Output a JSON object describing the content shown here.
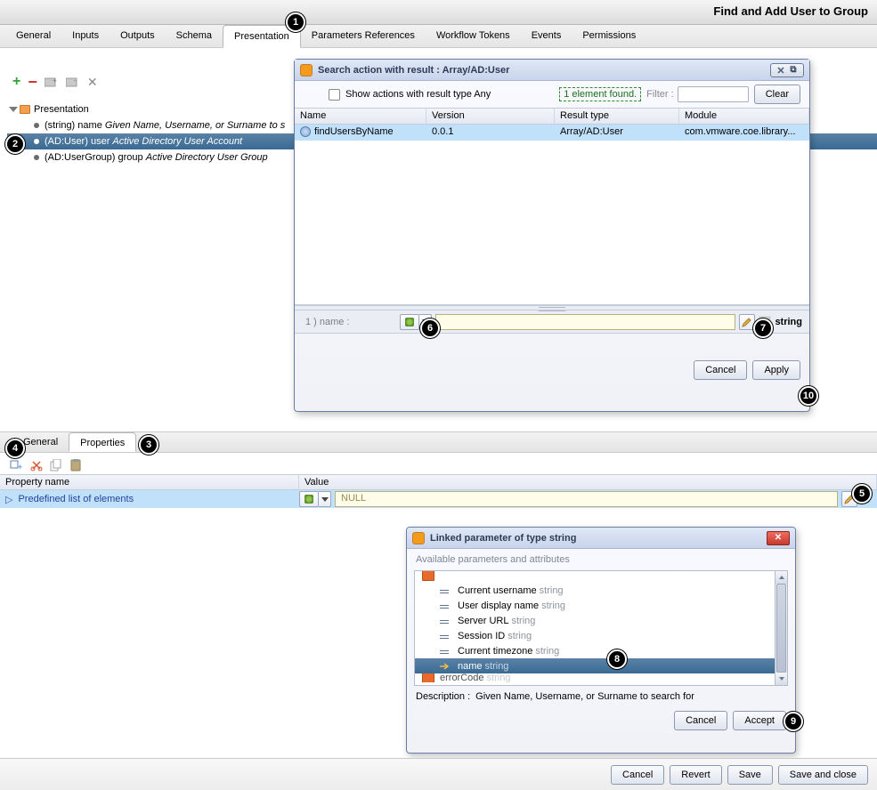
{
  "title": "Find and Add User to Group",
  "top_tabs": [
    "General",
    "Inputs",
    "Outputs",
    "Schema",
    "Presentation",
    "Parameters References",
    "Workflow Tokens",
    "Events",
    "Permissions"
  ],
  "top_tab_active": 4,
  "toolstrip_icons": [
    "add",
    "remove",
    "add-folder",
    "remove-folder",
    "delete"
  ],
  "tree": {
    "root": "Presentation",
    "items": [
      {
        "type": "(string)",
        "name": "name",
        "desc": "Given Name, Username, or Surname to s"
      },
      {
        "type": "(AD:User)",
        "name": "user",
        "desc": "Active Directory User Account",
        "selected": true
      },
      {
        "type": "(AD:UserGroup)",
        "name": "group",
        "desc": "Active Directory User Group"
      }
    ]
  },
  "search_dialog": {
    "title": "Search action with result : Array/AD:User",
    "show_any": "Show actions with result type Any",
    "found": "1 element found.",
    "filter_label": "Filter :",
    "clear": "Clear",
    "cols": [
      "Name",
      "Version",
      "Result type",
      "Module"
    ],
    "row": {
      "name": "findUsersByName",
      "version": "0.0.1",
      "rtype": "Array/AD:User",
      "module": "com.vmware.coe.library..."
    },
    "param_label": "1 ) name :",
    "param_type": "string",
    "cancel": "Cancel",
    "apply": "Apply"
  },
  "bottom_tabs": [
    "General",
    "Properties"
  ],
  "bottom_tab_active": 1,
  "prop_cols": [
    "Property name",
    "Value"
  ],
  "prop_row": {
    "name": "Predefined list of elements",
    "value": "NULL"
  },
  "linked_dialog": {
    "title": "Linked parameter of type string",
    "sub": "Available parameters and attributes",
    "items": [
      {
        "label": "Current username",
        "type": "string"
      },
      {
        "label": "User display name",
        "type": "string"
      },
      {
        "label": "Server URL",
        "type": "string"
      },
      {
        "label": "Session ID",
        "type": "string"
      },
      {
        "label": "Current timezone",
        "type": "string"
      },
      {
        "label": "name",
        "type": "string",
        "selected": true,
        "arrow": true
      },
      {
        "label": "errorCode",
        "type": "string",
        "cut": true
      }
    ],
    "desc_label": "Description :",
    "desc": "Given Name, Username, or Surname to search for",
    "cancel": "Cancel",
    "accept": "Accept"
  },
  "footer": {
    "cancel": "Cancel",
    "revert": "Revert",
    "save": "Save",
    "saveclose": "Save and close"
  },
  "callouts": {
    "c1": "1",
    "c2": "2",
    "c3": "3",
    "c4": "4",
    "c5": "5",
    "c6": "6",
    "c7": "7",
    "c8": "8",
    "c9": "9",
    "c10": "10"
  }
}
